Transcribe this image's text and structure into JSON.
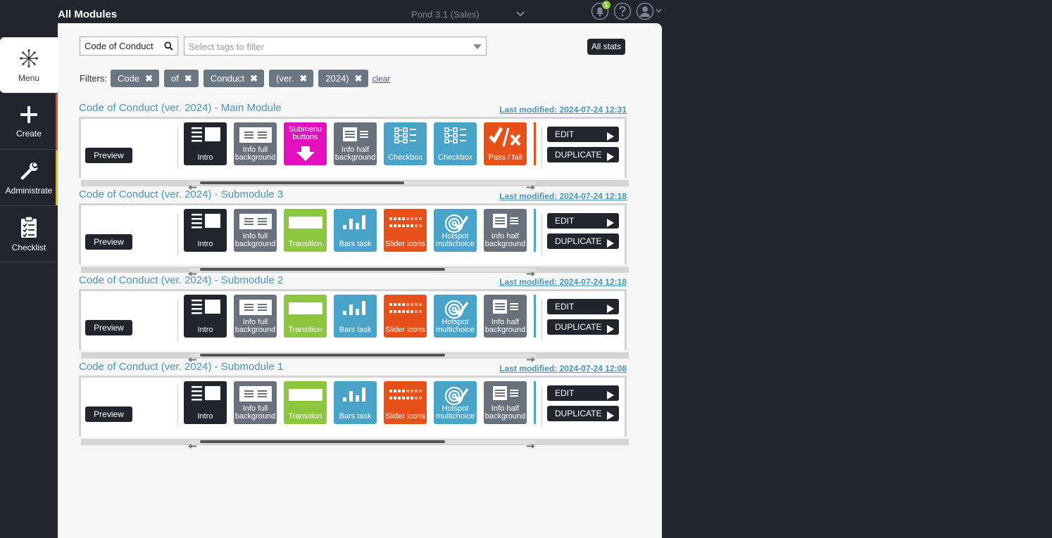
{
  "header": {
    "title": "All Modules",
    "app_selector": "Pond 3.1 (Sales)",
    "notification_count": "1"
  },
  "sidebar": {
    "items": [
      {
        "label": "Menu",
        "icon": "snowflake-icon"
      },
      {
        "label": "Create",
        "icon": "plus-icon"
      },
      {
        "label": "Administrate",
        "icon": "wrench-icon"
      },
      {
        "label": "Checklist",
        "icon": "clipboard-icon"
      }
    ]
  },
  "toolbar": {
    "search_value": "Code of Conduct (",
    "tags_placeholder": "Select tags to filter",
    "all_stats": "All stats"
  },
  "filters": {
    "label": "Filters:",
    "chips": [
      "Code",
      "of",
      "Conduct",
      "(ver.",
      "2024)"
    ],
    "clear": "clear"
  },
  "common": {
    "preview": "Preview",
    "edit": "EDIT",
    "duplicate": "DUPLICATE"
  },
  "modules": [
    {
      "title": "Code of Conduct (ver. 2024) - Main Module",
      "last_modified": "Last modified: 2024-07-24 12:31",
      "scroll_fraction": 0.66,
      "tiles": [
        {
          "label": "Intro",
          "color": "#22252e",
          "icon": "intro-layout-icon"
        },
        {
          "label": "Info full background",
          "color": "#69717c",
          "icon": "info-full-icon"
        },
        {
          "label": "Submenu buttons",
          "color": "#e30fbd",
          "icon": "down-arrow-icon"
        },
        {
          "label": "Info half background",
          "color": "#69717c",
          "icon": "info-half-icon"
        },
        {
          "label": "Checkbox",
          "color": "#4aa3c8",
          "icon": "checkbox-grid-icon"
        },
        {
          "label": "Checkbox",
          "color": "#4aa3c8",
          "icon": "checkbox-grid-icon"
        },
        {
          "label": "Pass / fail",
          "color": "#e8501a",
          "icon": "pass-fail-icon"
        }
      ],
      "peek_color": "#e8501a"
    },
    {
      "title": "Code of Conduct (ver. 2024) - Submodule 3",
      "last_modified": "Last modified: 2024-07-24 12:18",
      "scroll_fraction": 0.79,
      "tiles": [
        {
          "label": "Intro",
          "color": "#22252e",
          "icon": "intro-layout-icon"
        },
        {
          "label": "Info full background",
          "color": "#69717c",
          "icon": "info-full-icon"
        },
        {
          "label": "Transition",
          "color": "#8dc63f",
          "icon": "transition-icon"
        },
        {
          "label": "Bars task",
          "color": "#4aa3c8",
          "icon": "bars-chart-icon"
        },
        {
          "label": "Slider icons",
          "color": "#e8501a",
          "icon": "slider-dots-icon"
        },
        {
          "label": "Hotspot multichoice",
          "color": "#4aa3c8",
          "icon": "target-icon"
        },
        {
          "label": "Info half background",
          "color": "#69717c",
          "icon": "info-half-icon"
        }
      ],
      "peek_color": "#4aa3c8"
    },
    {
      "title": "Code of Conduct (ver. 2024) - Submodule 2",
      "last_modified": "Last modified: 2024-07-24 12:18",
      "scroll_fraction": 0.79,
      "tiles": [
        {
          "label": "Intro",
          "color": "#22252e",
          "icon": "intro-layout-icon"
        },
        {
          "label": "Info full background",
          "color": "#69717c",
          "icon": "info-full-icon"
        },
        {
          "label": "Transition",
          "color": "#8dc63f",
          "icon": "transition-icon"
        },
        {
          "label": "Bars task",
          "color": "#4aa3c8",
          "icon": "bars-chart-icon"
        },
        {
          "label": "Slider icons",
          "color": "#e8501a",
          "icon": "slider-dots-icon"
        },
        {
          "label": "Hotspot multichoice",
          "color": "#4aa3c8",
          "icon": "target-icon"
        },
        {
          "label": "Info half background",
          "color": "#69717c",
          "icon": "info-half-icon"
        }
      ],
      "peek_color": "#4aa3c8"
    },
    {
      "title": "Code of Conduct (ver. 2024) - Submodule 1",
      "last_modified": "Last modified: 2024-07-24 12:08",
      "scroll_fraction": 0.79,
      "tiles": [
        {
          "label": "Intro",
          "color": "#22252e",
          "icon": "intro-layout-icon"
        },
        {
          "label": "Info full background",
          "color": "#69717c",
          "icon": "info-full-icon"
        },
        {
          "label": "Transition",
          "color": "#8dc63f",
          "icon": "transition-icon"
        },
        {
          "label": "Bars task",
          "color": "#4aa3c8",
          "icon": "bars-chart-icon"
        },
        {
          "label": "Slider icons",
          "color": "#e8501a",
          "icon": "slider-dots-icon"
        },
        {
          "label": "Hotspot multichoice",
          "color": "#4aa3c8",
          "icon": "target-icon"
        },
        {
          "label": "Info half background",
          "color": "#69717c",
          "icon": "info-half-icon"
        }
      ],
      "peek_color": "#4aa3c8"
    }
  ]
}
